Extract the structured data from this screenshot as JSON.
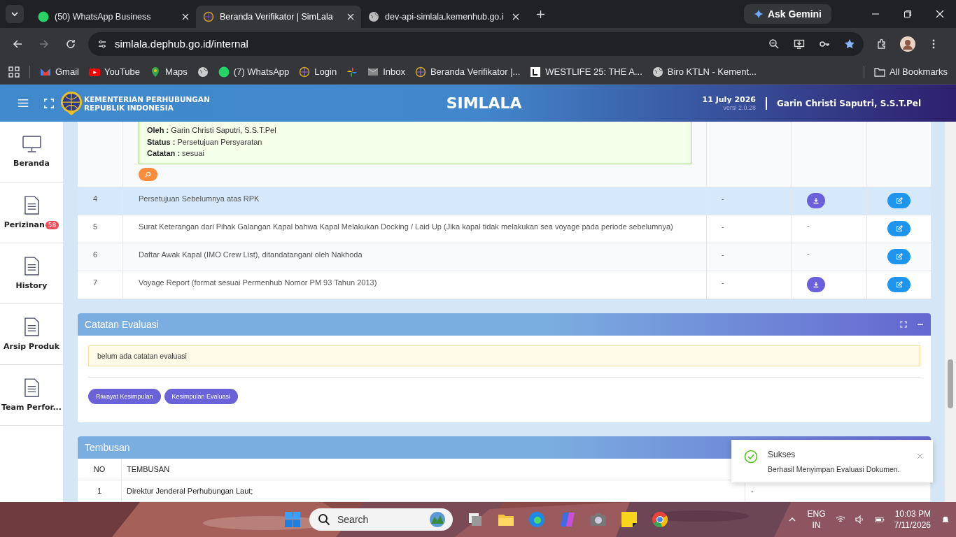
{
  "browser": {
    "tabs": [
      {
        "title": "(50) WhatsApp Business",
        "selected": false,
        "kind": "whatsapp"
      },
      {
        "title": "Beranda Verifikator | SimLala",
        "selected": true,
        "kind": "globe"
      },
      {
        "title": "dev-api-simlala.kemenhub.go.i",
        "selected": false,
        "kind": "world"
      }
    ],
    "ask_gemini": "Ask Gemini",
    "address": "simlala.dephub.go.id/internal",
    "bookmarks": [
      {
        "label": "Gmail",
        "kind": "mail"
      },
      {
        "label": "YouTube",
        "kind": "video"
      },
      {
        "label": "Maps",
        "kind": "pin"
      },
      {
        "kind": "world"
      },
      {
        "label": "(7) WhatsApp",
        "kind": "whatsapp"
      },
      {
        "label": "Login",
        "kind": "globe"
      },
      {
        "kind": "pinwheel"
      },
      {
        "label": "Inbox",
        "kind": "envelope"
      },
      {
        "label": "Beranda Verifikator |...",
        "kind": "globe"
      },
      {
        "label": "WESTLIFE 25: THE A...",
        "kind": "square"
      },
      {
        "label": "Biro KTLN - Kement...",
        "kind": "world"
      }
    ],
    "all_bookmarks": "All Bookmarks"
  },
  "header": {
    "org_line_1": "KEMENTERIAN PERHUBUNGAN",
    "org_line_2": "REPUBLIK INDONESIA",
    "title": "SIMLALA",
    "date": "11 July 2026",
    "version": "versi 2.0.28",
    "user": "Garin Christi Saputri, S.S.T.Pel"
  },
  "sidebar": [
    {
      "label": "Beranda",
      "kind": "monitor"
    },
    {
      "label": "Perizinan",
      "kind": "document",
      "badge": "58"
    },
    {
      "label": "History",
      "kind": "document"
    },
    {
      "label": "Arsip Produk",
      "kind": "document"
    },
    {
      "label": "Team Perfor...",
      "kind": "document"
    }
  ],
  "history_note": [
    {
      "label": "Oleh :",
      "value": "Garin Christi Saputri, S.S.T.Pel"
    },
    {
      "label": "Status :",
      "value": "Persetujuan Persyaratan"
    },
    {
      "label": "Catatan :",
      "value": "sesuai"
    }
  ],
  "documents": [
    {
      "no": "4",
      "name": "Persetujuan Sebelumnya atas RPK",
      "column_3": "-",
      "download": true,
      "selected": true
    },
    {
      "no": "5",
      "name": "Surat Keterangan dari Pihak Galangan Kapal bahwa Kapal Melakukan Docking / Laid Up (Jika kapal tidak melakukan sea voyage pada periode sebelumnya)",
      "column_3": "-",
      "download": false,
      "column_4": "-",
      "selected": false
    },
    {
      "no": "6",
      "name": "Daftar Awak Kapal (IMO Crew List), ditandatangani oleh Nakhoda",
      "column_3": "-",
      "download": false,
      "column_4": "-",
      "selected": false
    },
    {
      "no": "7",
      "name": "Voyage Report (format sesuai Permenhub Nomor PM 93 Tahun 2013)",
      "column_3": "-",
      "download": true,
      "selected": false
    }
  ],
  "evaluation": {
    "title": "Catatan Evaluasi",
    "note": "belum ada catatan evaluasi",
    "buttons": [
      "Riwayat Kesimpulan",
      "Kesimpulan Evaluasi"
    ]
  },
  "tembusan": {
    "title": "Tembusan",
    "columns": [
      "NO",
      "TEMBUSAN"
    ],
    "rows": [
      {
        "no": "1",
        "name": "Direktur Jenderal Perhubungan Laut;",
        "column_3": "-"
      }
    ]
  },
  "toast": {
    "title": "Sukses",
    "message": "Berhasil Menyimpan Evaluasi Dokumen."
  },
  "taskbar": {
    "search": "Search",
    "language": "ENG",
    "region": "IN",
    "time": "10:03 PM",
    "date": "7/11/2026"
  }
}
